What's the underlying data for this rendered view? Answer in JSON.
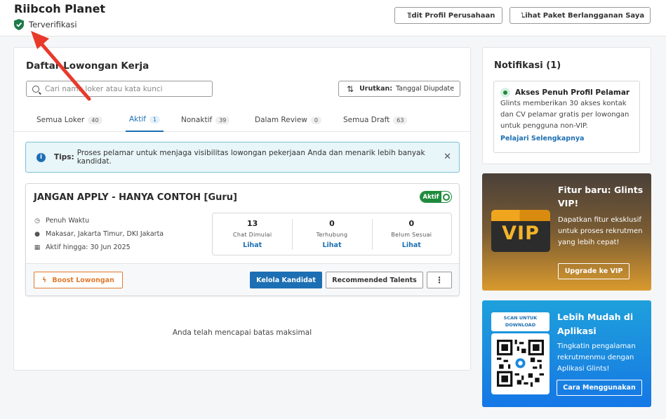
{
  "header": {
    "company_name": "Riibcoh Planet",
    "verified_label": "Terverifikasi",
    "edit_profile_label": "Edit Profil Perusahaan",
    "view_plan_label": "Lihat Paket Berlangganan Saya"
  },
  "jobs": {
    "title": "Daftar Lowongan Kerja",
    "search_placeholder": "Cari nama loker atau kata kunci",
    "sort_label": "Urutkan:",
    "sort_value": "Tanggal Diupdate",
    "tabs": [
      {
        "label": "Semua Loker",
        "count": "40"
      },
      {
        "label": "Aktif",
        "count": "1"
      },
      {
        "label": "Nonaktif",
        "count": "39"
      },
      {
        "label": "Dalam Review",
        "count": "0"
      },
      {
        "label": "Semua Draft",
        "count": "63"
      }
    ],
    "tips_label": "Tips:",
    "tips_text": "Proses pelamar untuk menjaga visibilitas lowongan pekerjaan Anda dan menarik lebih banyak kandidat.",
    "card": {
      "title": "JANGAN APPLY - HANYA CONTOH [Guru]",
      "status_label": "Aktif",
      "job_type": "Penuh Waktu",
      "location": "Makasar, Jakarta Timur, DKI Jakarta",
      "active_until": "Aktif hingga: 30 Jun 2025",
      "stats": [
        {
          "value": "13",
          "label": "Chat Dimulai",
          "link": "Lihat"
        },
        {
          "value": "0",
          "label": "Terhubung",
          "link": "Lihat"
        },
        {
          "value": "0",
          "label": "Belum Sesuai",
          "link": "Lihat"
        }
      ],
      "boost_label": "Boost Lowongan",
      "manage_label": "Kelola Kandidat",
      "recommended_label": "Recommended Talents",
      "more_label": "⋮"
    },
    "limit_text": "Anda telah mencapai batas maksimal"
  },
  "notifications": {
    "title": "Notifikasi (1)",
    "item_title": "Akses Penuh Profil Pelamar",
    "item_body": "Glints memberikan 30 akses kontak dan CV pelamar gratis per lowongan untuk pengguna non-VIP.",
    "item_link": "Pelajari Selengkapnya"
  },
  "vip": {
    "badge_text": "VIP",
    "title": "Fitur baru: Glints VIP!",
    "description": "Dapatkan fitur eksklusif untuk proses rekrutmen yang lebih cepat!",
    "button_label": "Upgrade ke VIP"
  },
  "app_promo": {
    "scan_label": "SCAN UNTUK DOWNLOAD",
    "title": "Lebih Mudah di Aplikasi",
    "description": "Tingkatin pengalaman rekrutmenmu dengan Aplikasi Glints!",
    "button_label": "Cara Menggunakan"
  },
  "colors": {
    "primary": "#1d6fb3",
    "success": "#1e8a3c",
    "boost": "#e07a2f",
    "annotation_arrow": "#e8392a"
  }
}
